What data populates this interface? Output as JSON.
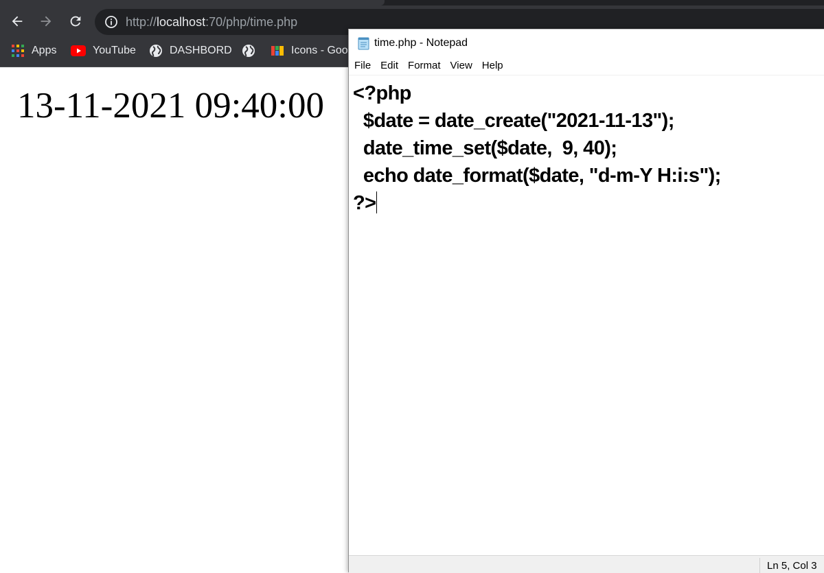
{
  "browser": {
    "url_scheme": "http://",
    "url_host": "localhost",
    "url_path": ":70/php/time.php",
    "bookmarks": [
      {
        "label": "Apps",
        "icon": "apps-grid-icon"
      },
      {
        "label": "YouTube",
        "icon": "youtube-icon"
      },
      {
        "label": "DASHBORD",
        "icon": "globe-icon"
      },
      {
        "label": "",
        "icon": "globe-icon"
      },
      {
        "label": "Icons - Goog",
        "icon": "icons8-icon"
      }
    ]
  },
  "page": {
    "output_text": "13-11-2021 09:40:00"
  },
  "notepad": {
    "title": "time.php - Notepad",
    "menu": [
      "File",
      "Edit",
      "Format",
      "View",
      "Help"
    ],
    "code_lines": [
      "<?php",
      "  $date = date_create(\"2021-11-13\");",
      "  date_time_set($date,  9, 40);",
      "  echo date_format($date, \"d-m-Y H:i:s\");",
      "?>"
    ],
    "status_position": "Ln 5, Col 3"
  },
  "colors": {
    "chrome_bg": "#35363a",
    "omnibox_bg": "#202124",
    "youtube_red": "#ff0000"
  }
}
